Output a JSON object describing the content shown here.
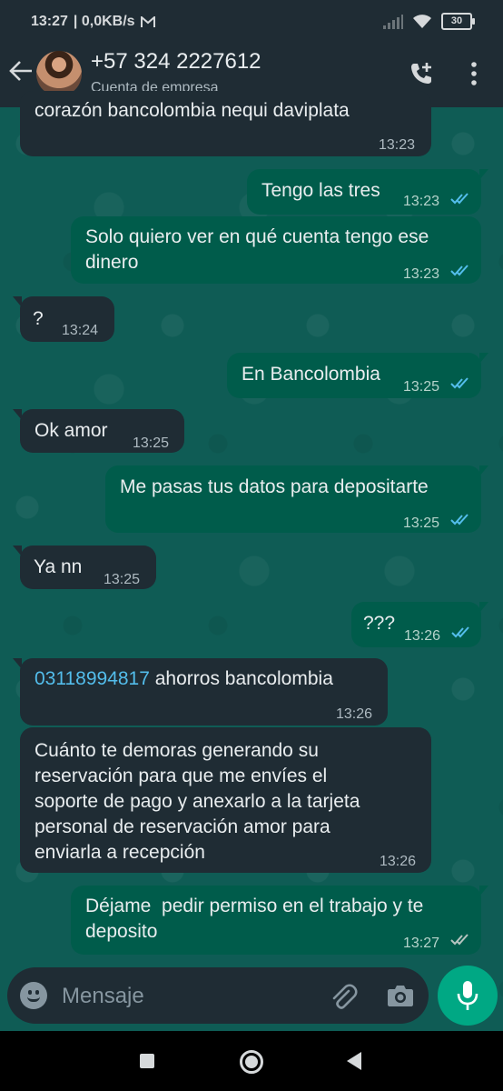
{
  "status_bar": {
    "time": "13:27",
    "data_rate": "| 0,0KB/s",
    "battery": "30"
  },
  "header": {
    "contact_name": "+57 324 2227612",
    "subtitle": "Cuenta de empresa"
  },
  "messages": [
    {
      "direction": "in",
      "text": "corazón bancolombia nequi daviplata",
      "time": "13:23"
    },
    {
      "direction": "out",
      "text": "Tengo las tres",
      "time": "13:23",
      "read": true
    },
    {
      "direction": "out",
      "text": "Solo quiero ver en qué cuenta tengo ese dinero",
      "time": "13:23",
      "read": true
    },
    {
      "direction": "in",
      "text": "?",
      "time": "13:24"
    },
    {
      "direction": "out",
      "text": "En Bancolombia",
      "time": "13:25",
      "read": true
    },
    {
      "direction": "in",
      "text": "Ok amor",
      "time": "13:25"
    },
    {
      "direction": "out",
      "text": "Me pasas tus datos para depositarte",
      "time": "13:25",
      "read": true
    },
    {
      "direction": "in",
      "text": "Ya nn",
      "time": "13:25"
    },
    {
      "direction": "out",
      "text": "???",
      "time": "13:26",
      "read": true
    },
    {
      "direction": "in",
      "link": "03118994817",
      "text": " ahorros bancolombia",
      "time": "13:26"
    },
    {
      "direction": "in",
      "text": "Cuánto te demoras generando su reservación para que me envíes el soporte de pago y anexarlo a la tarjeta personal de reservación amor para enviarla a recepción",
      "time": "13:26"
    },
    {
      "direction": "out",
      "text": "Déjame  pedir permiso en el trabajo y te deposito",
      "time": "13:27",
      "read": false
    }
  ],
  "composer": {
    "placeholder": "Mensaje"
  },
  "colors": {
    "incoming_bubble": "#1f2c34",
    "outgoing_bubble": "#005c4b",
    "accent": "#00a884",
    "read_ticks": "#53bdeb",
    "link": "#53bdeb"
  },
  "icons": [
    "back-arrow-icon",
    "add-call-icon",
    "more-options-icon",
    "emoji-icon",
    "attach-icon",
    "camera-icon",
    "mic-icon"
  ]
}
